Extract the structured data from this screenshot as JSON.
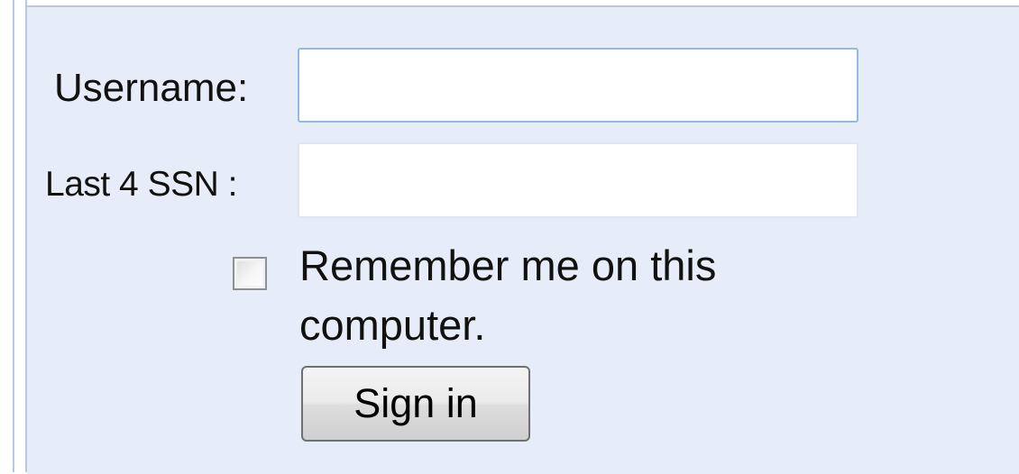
{
  "login_form": {
    "username_label": "Username:",
    "username_value": "",
    "ssn_label": "Last 4 SSN :",
    "ssn_value": "",
    "remember_label": "Remember me on this computer.",
    "remember_checked": false,
    "signin_label": "Sign in"
  },
  "colors": {
    "panel_background": "#e6edf8",
    "input_focus_border": "#94b9e3",
    "text": "#111111"
  }
}
